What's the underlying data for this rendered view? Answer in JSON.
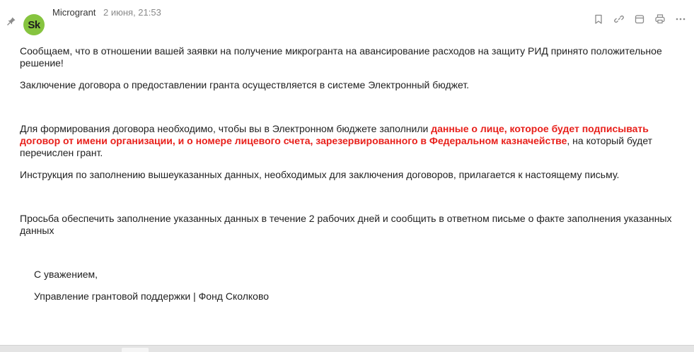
{
  "message": {
    "sender_name": "Microgrant",
    "date": "2 июня, 21:53",
    "avatar_text": "Sk",
    "avatar_color": "#86c43f"
  },
  "toolbar": {
    "icons": [
      "bookmark-icon",
      "link-icon",
      "calendar-icon",
      "print-icon",
      "more-icon"
    ]
  },
  "body": {
    "p1": "Сообщаем, что в отношении вашей заявки на получение микрогранта на авансирование расходов на защиту РИД принято положительное решение!",
    "p2": "Заключение договора о предоставлении гранта осуществляется в системе Электронный бюджет.",
    "p3_before": "Для формирования договора необходимо, чтобы вы в Электронном бюджете заполнили ",
    "p3_highlight": "данные о лице, которое будет подписывать договор от имени организации, и о номере лицевого счета, зарезервированного в Федеральном казначействе",
    "p3_after": ", на который будет перечислен грант.",
    "p4": "Инструкция по заполнению вышеуказанных данных, необходимых для заключения договоров, прилагается к настоящему письму.",
    "p5": "Просьба обеспечить заполнение указанных данных в течение 2 рабочих дней и сообщить в ответном письме о факте заполнения указанных данных",
    "closing": "С уважением,",
    "signature": "Управление грантовой поддержки | Фонд Сколково",
    "highlight_color": "#e8201b"
  }
}
